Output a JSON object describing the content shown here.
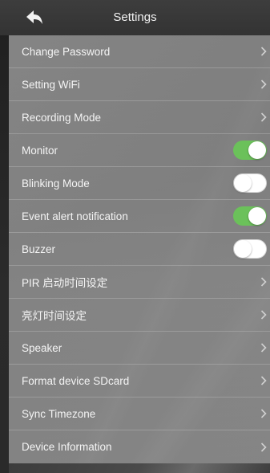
{
  "header": {
    "title": "Settings",
    "back_icon": "back-arrow-icon"
  },
  "colors": {
    "toggle_on": "#6bc15a",
    "toggle_off": "#ffffff",
    "text": "#f4f4f4"
  },
  "settings": [
    {
      "label": "Change Password",
      "type": "link"
    },
    {
      "label": "Setting WiFi",
      "type": "link"
    },
    {
      "label": "Recording Mode",
      "type": "link"
    },
    {
      "label": "Monitor",
      "type": "toggle",
      "on": true
    },
    {
      "label": "Blinking Mode",
      "type": "toggle",
      "on": false
    },
    {
      "label": "Event alert notification",
      "type": "toggle",
      "on": true
    },
    {
      "label": "Buzzer",
      "type": "toggle",
      "on": false
    },
    {
      "label": "PIR 启动时间设定",
      "type": "link"
    },
    {
      "label": "亮灯时间设定",
      "type": "link"
    },
    {
      "label": "Speaker",
      "type": "link"
    },
    {
      "label": "Format device SDcard",
      "type": "link"
    },
    {
      "label": "Sync Timezone",
      "type": "link"
    },
    {
      "label": "Device Information",
      "type": "link"
    }
  ]
}
